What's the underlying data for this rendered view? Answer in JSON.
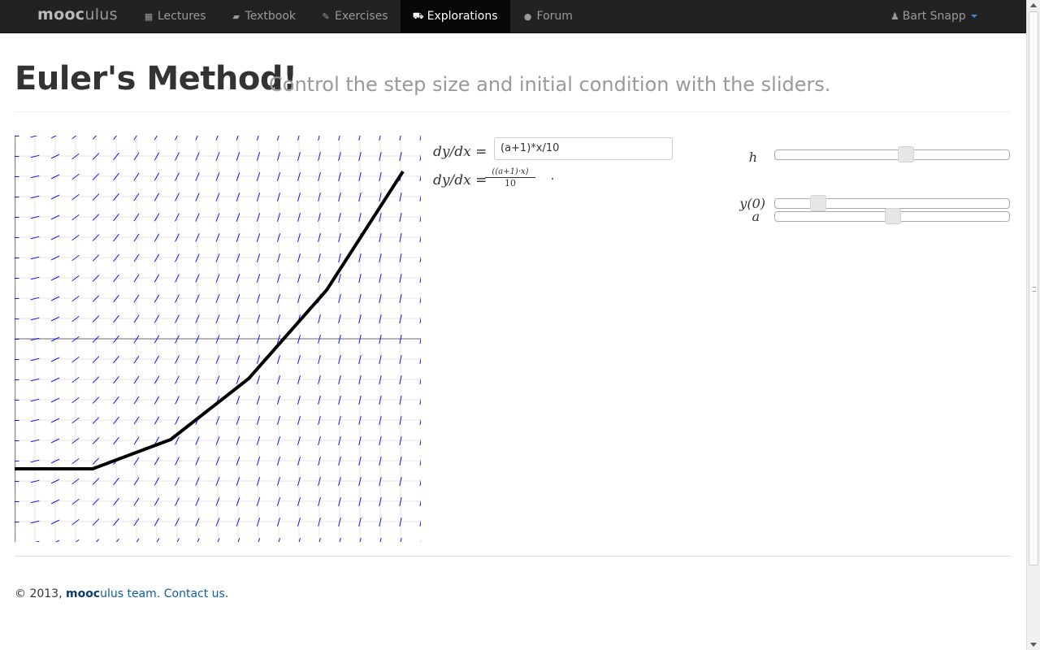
{
  "navbar": {
    "brand_bold": "mooc",
    "brand_rest": "ulus",
    "items": [
      {
        "label": "Lectures",
        "icon": "film-icon"
      },
      {
        "label": "Textbook",
        "icon": "book-icon"
      },
      {
        "label": "Exercises",
        "icon": "pencil-icon"
      },
      {
        "label": "Explorations",
        "icon": "truck-icon",
        "active": true
      },
      {
        "label": "Forum",
        "icon": "comments-icon"
      }
    ],
    "user": "Bart Snapp"
  },
  "header": {
    "title": "Euler's Method!",
    "subtitle": "Control the step size and initial condition with the sliders."
  },
  "equation": {
    "label": "dy/dx =",
    "input_value": "(a+1)*x/10",
    "rendered_numerator": "((a+1)·x)",
    "rendered_denominator": "10"
  },
  "sliders": [
    {
      "label": "h",
      "value_fraction": 0.56
    },
    {
      "label": "y(0)",
      "value_fraction": 0.16
    },
    {
      "label": "a",
      "value_fraction": 0.5
    }
  ],
  "footer": {
    "prefix": "© 2013, ",
    "brand_bold": "mooc",
    "brand_rest": "ulus",
    "team": " team.",
    "contact": "Contact us."
  },
  "colors": {
    "navbar_bg": "#222222",
    "active_nav_bg": "#080808",
    "slope_field": "#0000ff",
    "euler_path": "#000000",
    "link": "#0b5ea3"
  }
}
